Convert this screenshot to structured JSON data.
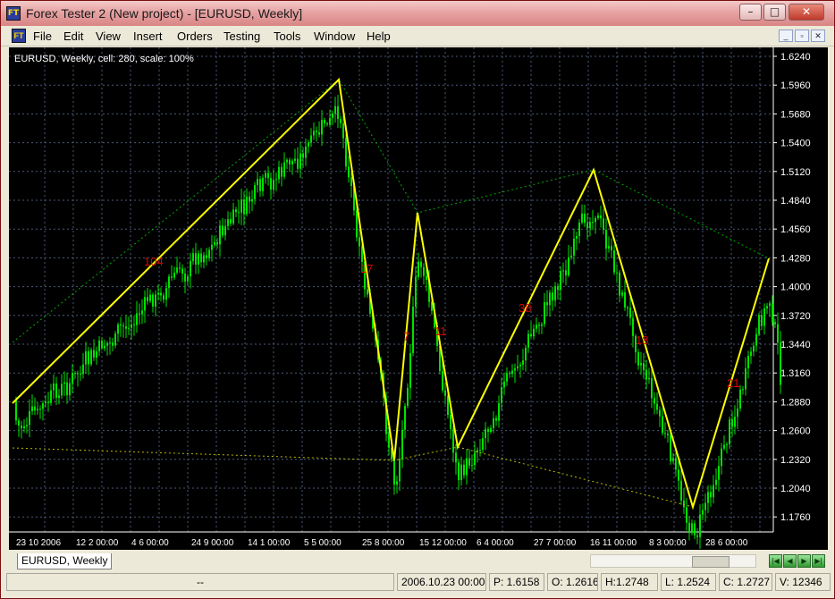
{
  "window": {
    "title": "Forex Tester 2  (New project) - [EURUSD, Weekly]",
    "app_icon_text": "FT",
    "minimize": "–",
    "maximize": "□",
    "close": "✕"
  },
  "menu": [
    "File",
    "Edit",
    "View",
    "Insert",
    "Orders",
    "Testing",
    "Tools",
    "Window",
    "Help"
  ],
  "mdi_buttons": [
    "_",
    "▫",
    "✕"
  ],
  "chart": {
    "info": "EURUSD, Weekly, cell: 280, scale: 100%",
    "price_labels": [
      "1.6240",
      "1.5960",
      "1.5680",
      "1.5400",
      "1.5120",
      "1.4840",
      "1.4560",
      "1.4280",
      "1.4000",
      "1.3720",
      "1.3440",
      "1.3160",
      "1.2880",
      "1.2600",
      "1.2320",
      "1.2040",
      "1.1760"
    ],
    "date_labels": [
      "23 10 2006",
      "12 2 00:00",
      "4 6 00:00",
      "24 9 00:00",
      "14 1 00:00",
      "5 5 00:00",
      "25 8 00:00",
      "15 12 00:00",
      "6 4 00:00",
      "27 7 00:00",
      "16 11 00:00",
      "8 3 00:00",
      "28 6 00:00"
    ],
    "wave_labels": [
      "104",
      "17",
      "7",
      "11",
      "38",
      "18",
      "21"
    ],
    "colors": {
      "background": "#000000",
      "candles": "#00e000",
      "zigzag": "#ffff00",
      "channel": "#00aa00",
      "wave_labels": "#e00000",
      "grid": "#4a5a78"
    }
  },
  "tabs": {
    "active": "EURUSD, Weekly"
  },
  "nav_buttons": [
    "first-icon",
    "prev-icon",
    "play-icon",
    "last-icon"
  ],
  "status": {
    "message": "--",
    "datetime": "2006.10.23 00:00",
    "price": "P: 1.6158",
    "open": "O: 1.2616",
    "high": "H:1.2748",
    "low": "L: 1.2524",
    "close": "C: 1.2727",
    "volume": "V: 12346"
  }
}
